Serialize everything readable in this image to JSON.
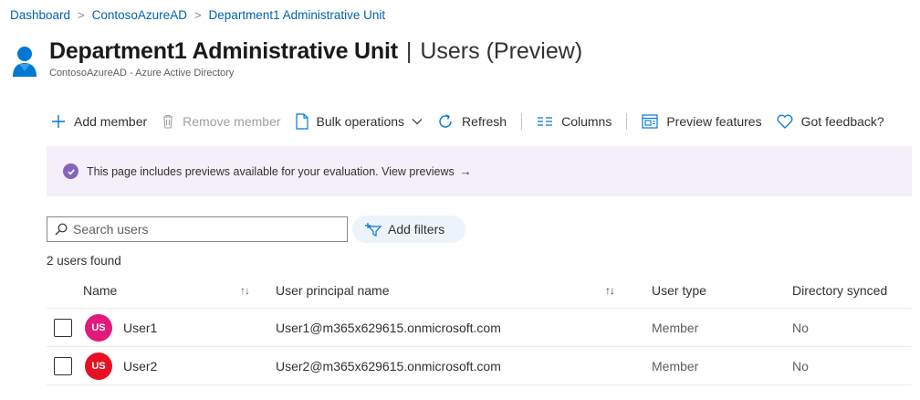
{
  "breadcrumb": {
    "items": [
      "Dashboard",
      "ContosoAzureAD",
      "Department1 Administrative Unit"
    ],
    "separator": ">"
  },
  "header": {
    "title": "Department1 Administrative Unit",
    "divider": "|",
    "section": "Users (Preview)",
    "caption": "ContosoAzureAD - Azure Active Directory",
    "icon": "user-icon"
  },
  "toolbar": {
    "add_member": "Add member",
    "remove_member": "Remove member",
    "bulk_operations": "Bulk operations",
    "refresh": "Refresh",
    "columns": "Columns",
    "preview_features": "Preview features",
    "got_feedback": "Got feedback?"
  },
  "banner": {
    "text": "This page includes previews available for your evaluation. View previews",
    "arrow": "→"
  },
  "search": {
    "placeholder": "Search users"
  },
  "filters": {
    "add_label": "Add filters"
  },
  "results": {
    "count_text": "2 users found"
  },
  "table": {
    "columns": [
      "Name",
      "User principal name",
      "User type",
      "Directory synced"
    ],
    "rows": [
      {
        "initials": "US",
        "name": "User1",
        "upn": "User1@m365x629615.onmicrosoft.com",
        "type": "Member",
        "synced": "No",
        "avatar_color": "#e3197b"
      },
      {
        "initials": "US",
        "name": "User2",
        "upn": "User2@m365x629615.onmicrosoft.com",
        "type": "Member",
        "synced": "No",
        "avatar_color": "#e81123"
      }
    ]
  },
  "colors": {
    "link": "#0063b1",
    "accent": "#0078d4",
    "banner_bg": "#f4eff8",
    "banner_icon": "#8764b8"
  }
}
